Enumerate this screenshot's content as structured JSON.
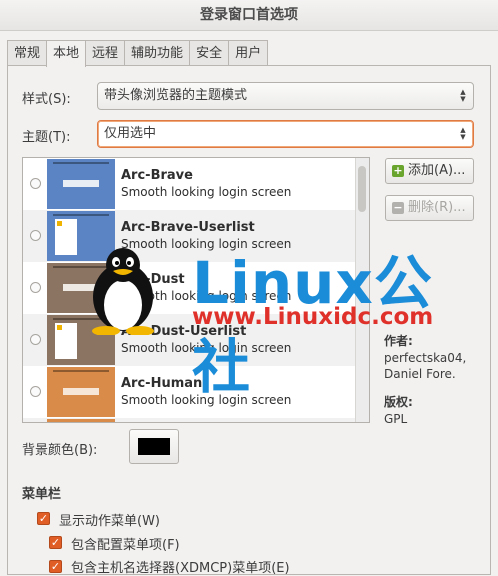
{
  "window": {
    "title": "登录窗口首选项"
  },
  "tabs": [
    {
      "label": "常规",
      "active": false
    },
    {
      "label": "本地",
      "active": true
    },
    {
      "label": "远程",
      "active": false
    },
    {
      "label": "辅助功能",
      "active": false
    },
    {
      "label": "安全",
      "active": false
    },
    {
      "label": "用户",
      "active": false
    }
  ],
  "style_field": {
    "label": "样式(S):",
    "value": "带头像浏览器的主题模式"
  },
  "theme_field": {
    "label": "主题(T):",
    "value": "仅用选中"
  },
  "themes": [
    {
      "name": "Arc-Brave",
      "desc": "Smooth looking login screen",
      "color": "#5b84c4",
      "variant": "plain"
    },
    {
      "name": "Arc-Brave-Userlist",
      "desc": "Smooth looking login screen",
      "color": "#5b84c4",
      "variant": "userlist"
    },
    {
      "name": "Arc-Dust",
      "desc": "Smooth looking login screen",
      "color": "#8c7462",
      "variant": "plain"
    },
    {
      "name": "Arc-Dust-Userlist",
      "desc": "Smooth looking login screen",
      "color": "#8c7462",
      "variant": "userlist"
    },
    {
      "name": "Arc-Human",
      "desc": "Smooth looking login screen",
      "color": "#d98b4a",
      "variant": "plain"
    }
  ],
  "buttons": {
    "add": "添加(A)...",
    "remove": "删除(R)..."
  },
  "info": {
    "author_label": "作者:",
    "author_value": "perfectska04, Daniel Fore.",
    "license_label": "版权:",
    "license_value": "GPL"
  },
  "background_color": {
    "label": "背景颜色(B):",
    "value": "#000000"
  },
  "menubar": {
    "title": "菜单栏",
    "items": [
      {
        "label": "显示动作菜单(W)",
        "checked": true
      },
      {
        "label": "包含配置菜单项(F)",
        "checked": true
      },
      {
        "label": "包含主机名选择器(XDMCP)菜单项(E)",
        "checked": true
      }
    ]
  },
  "watermark": {
    "text": "Linux公社",
    "url": "www.Linuxidc.com"
  },
  "colors": {
    "accent": "#e05d25",
    "focus": "#e07a44",
    "wm_blue": "#1a8cd8",
    "wm_red": "#e0302a"
  }
}
